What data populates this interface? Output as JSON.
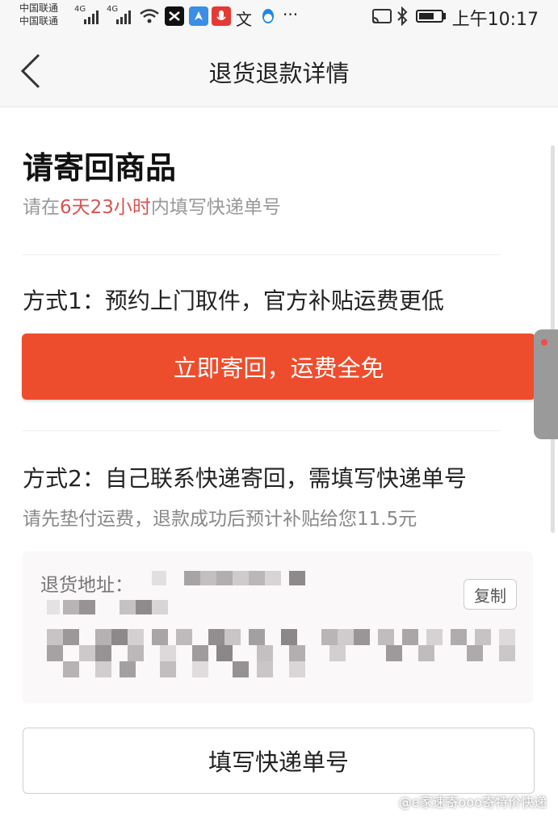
{
  "status_bar": {
    "carrier_1": "中国联通",
    "carrier_2": "中国联通",
    "signal_1": "4G",
    "signal_2": "4G",
    "time": "上午10:17",
    "icons": [
      "capcut-icon",
      "maps-icon",
      "mic-icon",
      "translate-icon",
      "qq-icon",
      "more-icon",
      "cast-icon",
      "bluetooth-icon",
      "battery-icon"
    ]
  },
  "nav": {
    "title": "退货退款详情",
    "back_icon": "chevron-left-icon"
  },
  "return_section": {
    "heading": "请寄回商品",
    "subtitle_pre": "请在",
    "subtitle_time": "6天23小时",
    "subtitle_post": "内填写快递单号"
  },
  "method_1": {
    "title": "方式1：预约上门取件，官方补贴运费更低",
    "button_label": "立即寄回，运费全免"
  },
  "method_2": {
    "title": "方式2：自己联系快递寄回，需填写快递单号",
    "note": "请先垫付运费，退款成功后预计补贴给您11.5元"
  },
  "address": {
    "label": "退货地址：",
    "copy_label": "复制"
  },
  "tracking_button": {
    "label": "填写快递单号"
  },
  "watermark": "@e家速寄ooo寄特价快递",
  "colors": {
    "primary": "#ee4d2d",
    "highlight": "#d9534f",
    "muted_text": "#999999"
  }
}
